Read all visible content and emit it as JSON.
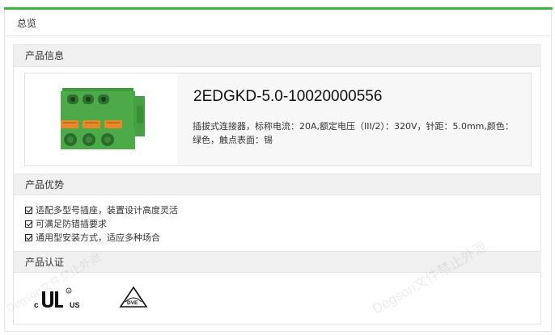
{
  "overview_tab": "总览",
  "sections": {
    "info": "产品信息",
    "advantages": "产品优势",
    "certification": "产品认证"
  },
  "product": {
    "name": "2EDGKD-5.0-10020000556",
    "description": "插拔式连接器，标称电流：20A,额定电压（III/2）：320V，针距：5.0mm,颜色：绿色，触点表面：锡"
  },
  "advantages": [
    "适配多型号插座，装置设计高度灵活",
    "可满足防错插要求",
    "通用型安装方式，适应多种场合"
  ],
  "certifications": [
    {
      "icon": "cul-us-icon",
      "mark": "c UL us"
    },
    {
      "icon": "vde-icon",
      "mark": "DVE"
    }
  ],
  "watermark": "Degson文件禁止外泄",
  "colors": {
    "accent": "#3cb43c",
    "connector": "#4caa49",
    "latch": "#e8882a"
  }
}
